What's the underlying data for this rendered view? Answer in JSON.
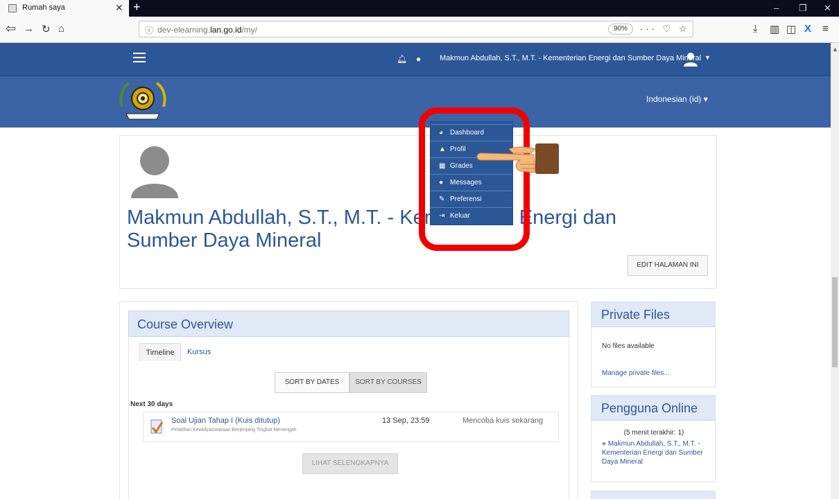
{
  "browser": {
    "tab_title": "Rumah saya",
    "new_tab": "+",
    "url_host": "dev-elearning.",
    "url_domain": "lan.go.id",
    "url_path": "/my/",
    "zoom": "90%",
    "url_actions": "··· ♡ ☆"
  },
  "topnav": {
    "user_name": "Makmun Abdullah, S.T., M.T. - Kementerian Energi dan Sumber Daya Mineral"
  },
  "header": {
    "language": "Indonesian (id) ▾"
  },
  "user_menu": {
    "items": [
      {
        "label": "Dashboard",
        "icon": "dashboard-icon"
      },
      {
        "label": "Profil",
        "icon": "user-icon"
      },
      {
        "label": "Grades",
        "icon": "table-icon"
      },
      {
        "label": "Messages",
        "icon": "chat-icon"
      },
      {
        "label": "Preferensi",
        "icon": "wrench-icon"
      },
      {
        "label": "Keluar",
        "icon": "sign-out-icon"
      }
    ]
  },
  "profile": {
    "full_name": "Makmun Abdullah, S.T., M.T. - Kementerian Energi dan Sumber Daya Mineral",
    "edit_button": "EDIT HALAMAN INI"
  },
  "course_overview": {
    "title": "Course Overview",
    "tabs": [
      "Timeline",
      "Kursus"
    ],
    "sort_dates": "SORT BY DATES",
    "sort_courses": "SORT BY COURSES",
    "section_label": "Next 30 days",
    "event": {
      "title": "Soal Ujian Tahap I (Kuis ditutup)",
      "course": "Pelatihan Kewidyaiswaraan Berjenjang Tingkat Menengah",
      "date": "13 Sep, 23:59",
      "action": "Mencoba kuis sekarang"
    },
    "more_button": "LIHAT SELENGKAPNYA"
  },
  "private_files": {
    "title": "Private Files",
    "empty_text": "No files available",
    "manage_link": "Manage private files..."
  },
  "online_users": {
    "title": "Pengguna Online",
    "subtitle": "(5 menit terakhir: 1)",
    "user": "Makmun Abdullah, S.T., M.T. - Kementerian Energi dan Sumber Daya Mineral"
  },
  "colors": {
    "navbar": "#2b5797",
    "header": "#3a64a6",
    "highlight": "#f20000",
    "link": "#2b5797"
  }
}
